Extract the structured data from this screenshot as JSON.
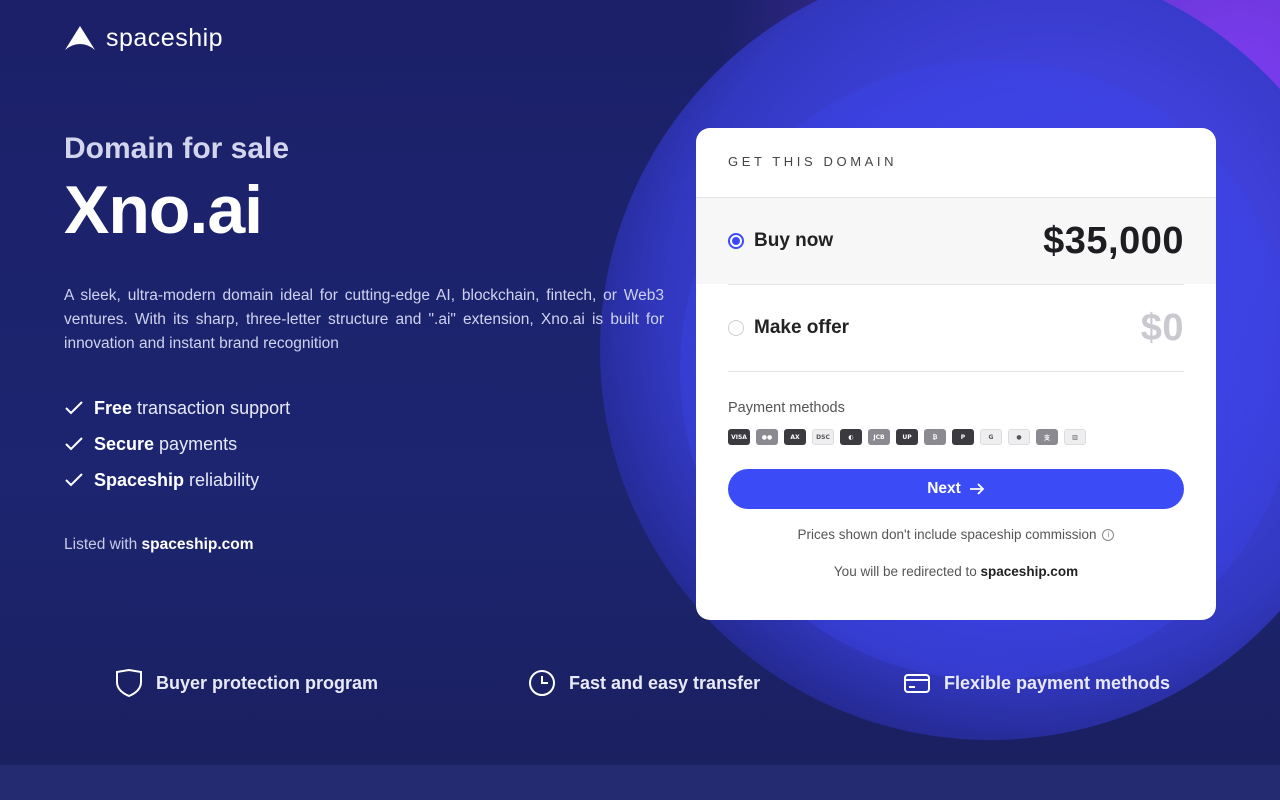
{
  "brand": {
    "name": "spaceship"
  },
  "hero": {
    "kicker": "Domain for sale",
    "domain": "Xno.ai",
    "description": "A sleek, ultra-modern domain ideal for cutting-edge AI, blockchain, fintech, or Web3 ventures. With its sharp, three-letter structure and \".ai\" extension, Xno.ai is built for innovation and instant brand recognition",
    "features": [
      {
        "bold": "Free",
        "rest": "transaction support"
      },
      {
        "bold": "Secure",
        "rest": "payments"
      },
      {
        "bold": "Spaceship",
        "rest": "reliability"
      }
    ],
    "listed_prefix": "Listed with",
    "listed_site": "spaceship.com"
  },
  "card": {
    "heading": "GET THIS DOMAIN",
    "buy_label": "Buy now",
    "buy_price": "$35,000",
    "offer_label": "Make offer",
    "offer_price": "$0",
    "payment_title": "Payment methods",
    "payment_icons": [
      "visa-icon",
      "mastercard-icon",
      "amex-icon",
      "discover-icon",
      "diners-icon",
      "jcb-icon",
      "unionpay-icon",
      "bitcoin-icon",
      "paypal-icon",
      "google-pay-icon",
      "apple-pay-icon",
      "alipay-icon",
      "bank-icon"
    ],
    "next_label": "Next",
    "commission_note": "Prices shown don't include spaceship commission",
    "redirect_prefix": "You will be redirected to",
    "redirect_site": "spaceship.com"
  },
  "bottom": {
    "items": [
      {
        "label": "Buyer protection program",
        "icon": "shield-icon"
      },
      {
        "label": "Fast and easy transfer",
        "icon": "clock-icon"
      },
      {
        "label": "Flexible payment methods",
        "icon": "card-icon"
      }
    ]
  },
  "colors": {
    "accent": "#3b4cf7",
    "bg": "#1b2164",
    "orb": "#4c4ef0",
    "glow": "#7b3cf0"
  }
}
